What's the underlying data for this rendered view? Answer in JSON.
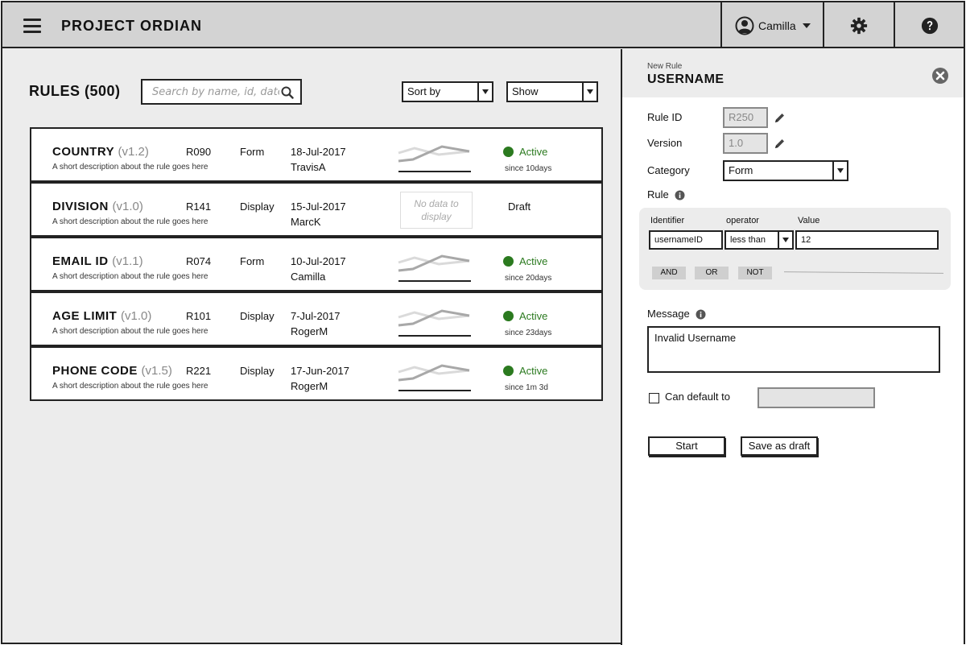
{
  "header": {
    "app_title": "PROJECT ORDIAN",
    "user_name": "Camilla"
  },
  "main": {
    "title": "RULES (500)",
    "search_placeholder": "Search by name, id, date,...",
    "sort_label": "Sort by",
    "show_label": "Show"
  },
  "rules": [
    {
      "name": "COUNTRY",
      "version": "(v1.2)",
      "desc": "A short description about the rule goes here",
      "id": "R090",
      "type": "Form",
      "date": "18-Jul-2017",
      "author": "TravisA",
      "status": "Active",
      "since": "since 10days",
      "has_data": true
    },
    {
      "name": "DIVISION",
      "version": "(v1.0)",
      "desc": "A short description about the rule goes here",
      "id": "R141",
      "type": "Display",
      "date": "15-Jul-2017",
      "author": "MarcK",
      "status": "Draft",
      "since": "",
      "has_data": false,
      "nodata_text": "No data to display"
    },
    {
      "name": "EMAIL ID",
      "version": "(v1.1)",
      "desc": "A short description about the rule goes here",
      "id": "R074",
      "type": "Form",
      "date": "10-Jul-2017",
      "author": "Camilla",
      "status": "Active",
      "since": "since 20days",
      "has_data": true
    },
    {
      "name": "AGE LIMIT",
      "version": "(v1.0)",
      "desc": "A short description about the rule goes here",
      "id": "R101",
      "type": "Display",
      "date": "7-Jul-2017",
      "author": "RogerM",
      "status": "Active",
      "since": "since 23days",
      "has_data": true
    },
    {
      "name": "PHONE CODE",
      "version": "(v1.5)",
      "desc": "A short description about the rule goes here",
      "id": "R221",
      "type": "Display",
      "date": "17-Jun-2017",
      "author": "RogerM",
      "status": "Active",
      "since": "since 1m 3d",
      "has_data": true
    }
  ],
  "panel": {
    "kicker": "New Rule",
    "title": "USERNAME",
    "rule_id_label": "Rule ID",
    "rule_id_value": "R250",
    "version_label": "Version",
    "version_value": "1.0",
    "category_label": "Category",
    "category_value": "Form",
    "rule_label": "Rule",
    "identifier_label": "Identifier",
    "operator_label": "operator",
    "value_label": "Value",
    "identifier_value": "usernameID",
    "operator_value": "less than",
    "value_value": "12",
    "chip_and": "AND",
    "chip_or": "OR",
    "chip_not": "NOT",
    "message_label": "Message",
    "message_value": "Invalid Username",
    "default_label": "Can default to",
    "start_label": "Start",
    "save_draft_label": "Save as draft"
  },
  "colors": {
    "active_green": "#2b7a1f",
    "header_bg": "#d3d3d3",
    "page_bg": "#ececec"
  }
}
